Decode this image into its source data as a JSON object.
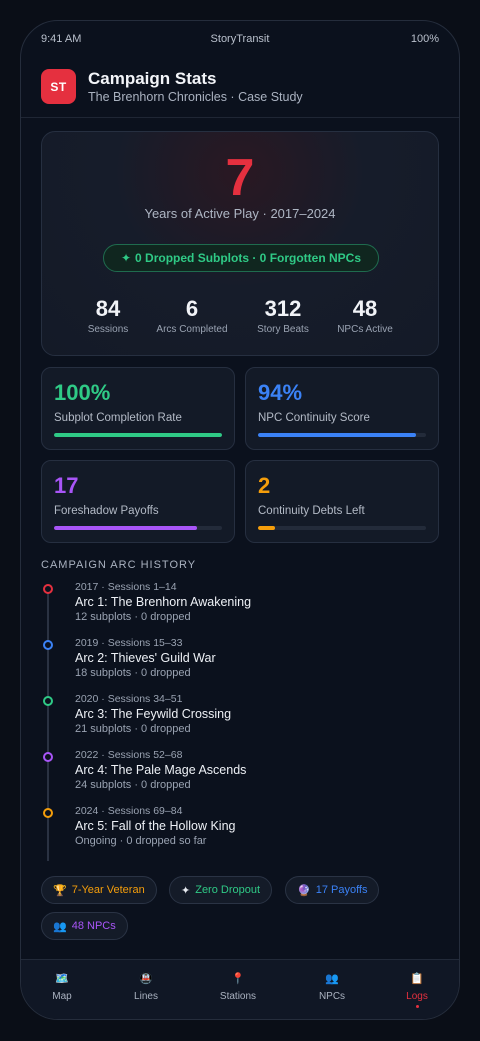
{
  "status_bar": {
    "time": "9:41 AM",
    "app_name": "StoryTransit",
    "battery": "100%"
  },
  "header": {
    "logo_text": "ST",
    "title": "Campaign Stats",
    "subtitle": "The Brenhorn Chronicles · Case Study"
  },
  "hero": {
    "years_value": "7",
    "years_label": "Years of Active Play · 2017–2024",
    "pill_icon": "✦",
    "pill_text": "0 Dropped Subplots · 0 Forgotten NPCs",
    "stats": [
      {
        "value": "84",
        "label": "Sessions"
      },
      {
        "value": "6",
        "label": "Arcs Completed"
      },
      {
        "value": "312",
        "label": "Story Beats"
      },
      {
        "value": "48",
        "label": "NPCs Active"
      }
    ]
  },
  "metrics": [
    {
      "value": "100%",
      "label": "Subplot Completion Rate",
      "color": "#2fca86",
      "progress": 1.0
    },
    {
      "value": "94%",
      "label": "NPC Continuity Score",
      "color": "#3b82f6",
      "progress": 0.94
    },
    {
      "value": "17",
      "label": "Foreshadow Payoffs",
      "color": "#a855f7",
      "progress": 0.85
    },
    {
      "value": "2",
      "label": "Continuity Debts Left",
      "color": "#f59e0b",
      "progress": 0.1
    }
  ],
  "arc_history": {
    "title": "CAMPAIGN ARC HISTORY",
    "arcs": [
      {
        "meta": "2017 · Sessions 1–14",
        "name": "Arc 1: The Brenhorn Awakening",
        "detail": "12 subplots · 0 dropped",
        "color": "#e5303f"
      },
      {
        "meta": "2019 · Sessions 15–33",
        "name": "Arc 2: Thieves' Guild War",
        "detail": "18 subplots · 0 dropped",
        "color": "#3b82f6"
      },
      {
        "meta": "2020 · Sessions 34–51",
        "name": "Arc 3: The Feywild Crossing",
        "detail": "21 subplots · 0 dropped",
        "color": "#2fca86"
      },
      {
        "meta": "2022 · Sessions 52–68",
        "name": "Arc 4: The Pale Mage Ascends",
        "detail": "24 subplots · 0 dropped",
        "color": "#a855f7"
      },
      {
        "meta": "2024 · Sessions 69–84",
        "name": "Arc 5: Fall of the Hollow King",
        "detail": "Ongoing · 0 dropped so far",
        "color": "#f59e0b"
      }
    ]
  },
  "badges": [
    {
      "icon": "🏆",
      "label": "7-Year Veteran",
      "color": "#f59e0b",
      "icon_name": "trophy-icon"
    },
    {
      "icon": "✦",
      "label": "Zero Dropout",
      "color": "#2fca86",
      "icon_name": "sparkle-icon"
    },
    {
      "icon": "🔮",
      "label": "17 Payoffs",
      "color": "#3b82f6",
      "icon_name": "crystal-ball-icon"
    },
    {
      "icon": "👥",
      "label": "48 NPCs",
      "color": "#a855f7",
      "icon_name": "people-icon"
    }
  ],
  "tabs": [
    {
      "icon": "🗺️",
      "label": "Map",
      "icon_name": "map-icon"
    },
    {
      "icon": "🚇",
      "label": "Lines",
      "icon_name": "metro-icon"
    },
    {
      "icon": "📍",
      "label": "Stations",
      "icon_name": "pin-icon"
    },
    {
      "icon": "👥",
      "label": "NPCs",
      "icon_name": "people-icon"
    },
    {
      "icon": "📋",
      "label": "Logs",
      "icon_name": "clipboard-icon",
      "active": true
    }
  ]
}
